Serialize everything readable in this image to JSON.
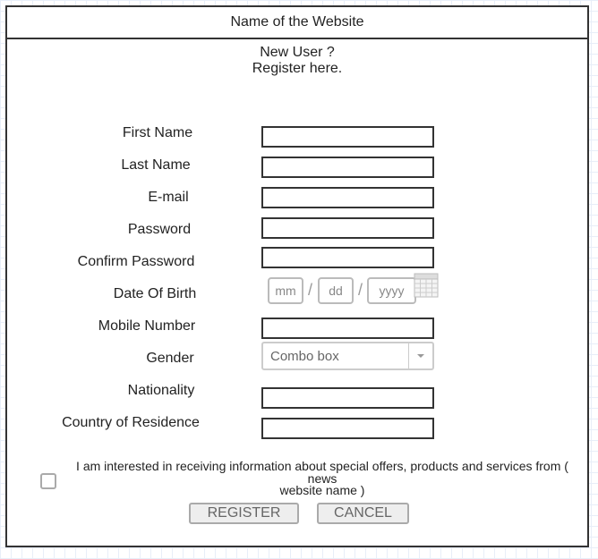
{
  "header": {
    "title": "Name of the Website"
  },
  "intro": {
    "line1": "New User ?",
    "line2": "Register here."
  },
  "form": {
    "first_name_label": "First Name",
    "last_name_label": "Last Name",
    "email_label": "E-mail",
    "password_label": "Password",
    "confirm_password_label": "Confirm Password",
    "dob_label": "Date Of Birth",
    "dob_month_placeholder": "mm",
    "dob_day_placeholder": "dd",
    "dob_year_placeholder": "yyyy",
    "dob_separator": "/",
    "mobile_label": "Mobile Number",
    "gender_label": "Gender",
    "gender_value": "Combo box",
    "nationality_label": "Nationality",
    "country_label": "Country of Residence"
  },
  "consent": {
    "text_line1": "I am interested in receiving information about special offers, products and services from ( news",
    "text_line2": "website name )",
    "checked": false
  },
  "buttons": {
    "register": "REGISTER",
    "cancel": "CANCEL"
  }
}
